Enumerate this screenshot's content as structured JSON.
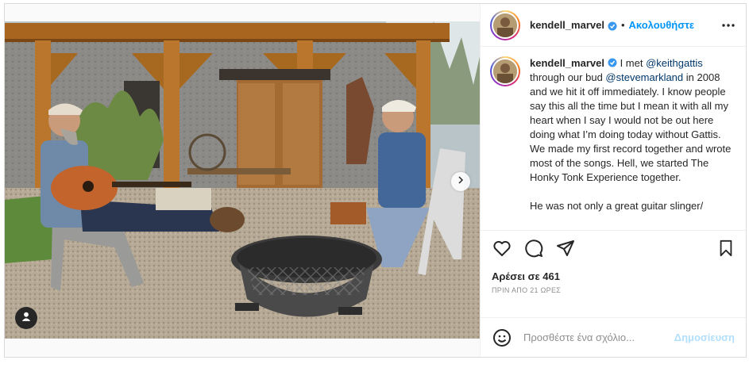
{
  "post": {
    "username": "kendell_marvel",
    "separator": "•",
    "follow_label": "Ακολουθήστε",
    "caption": {
      "username": "kendell_marvel",
      "t1": " I met ",
      "mention1": "@keithgattis",
      "t2": " through our bud ",
      "mention2": "@stevemarkland",
      "t3": " in 2008 and we hit it off immediately. I know people say this all the time but I mean it with all my heart when I say I would not be out here doing what I’m doing today without Gattis. We made my first record together and wrote most of the songs. Hell, we started The Honky Tonk Experience together.",
      "p2": "He was not only a great guitar slinger/"
    },
    "likes": "Αρέσει σε 461",
    "time": "ΠΡΙΝ ΑΠΟ 21 ΩΡΕΣ",
    "comment_placeholder": "Προσθέστε ένα σχόλιο...",
    "publish_label": "Δημοσίευση"
  },
  "icons": {
    "verified": "verified-badge-icon",
    "more": "more-options-icon",
    "like": "heart-icon",
    "comment": "comment-icon",
    "share": "share-icon",
    "save": "bookmark-icon",
    "emoji": "emoji-icon",
    "tag": "user-tag-icon",
    "next": "chevron-right-icon"
  },
  "colors": {
    "accent": "#0095f6",
    "mention": "#00376b",
    "publish_disabled": "#b2dffc",
    "verified": "#3897f0"
  }
}
